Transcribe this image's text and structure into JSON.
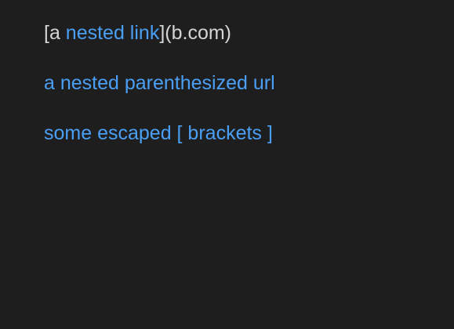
{
  "colors": {
    "background": "#1e1e1e",
    "text": "#d4d4d4",
    "link": "#4a9ff5"
  },
  "lines": [
    {
      "prefix": "[a ",
      "link_text": "nested link",
      "suffix": "](b.com)"
    },
    {
      "link_text": "a nested parenthesized url"
    },
    {
      "link_text": "some escaped [ brackets ]"
    }
  ]
}
